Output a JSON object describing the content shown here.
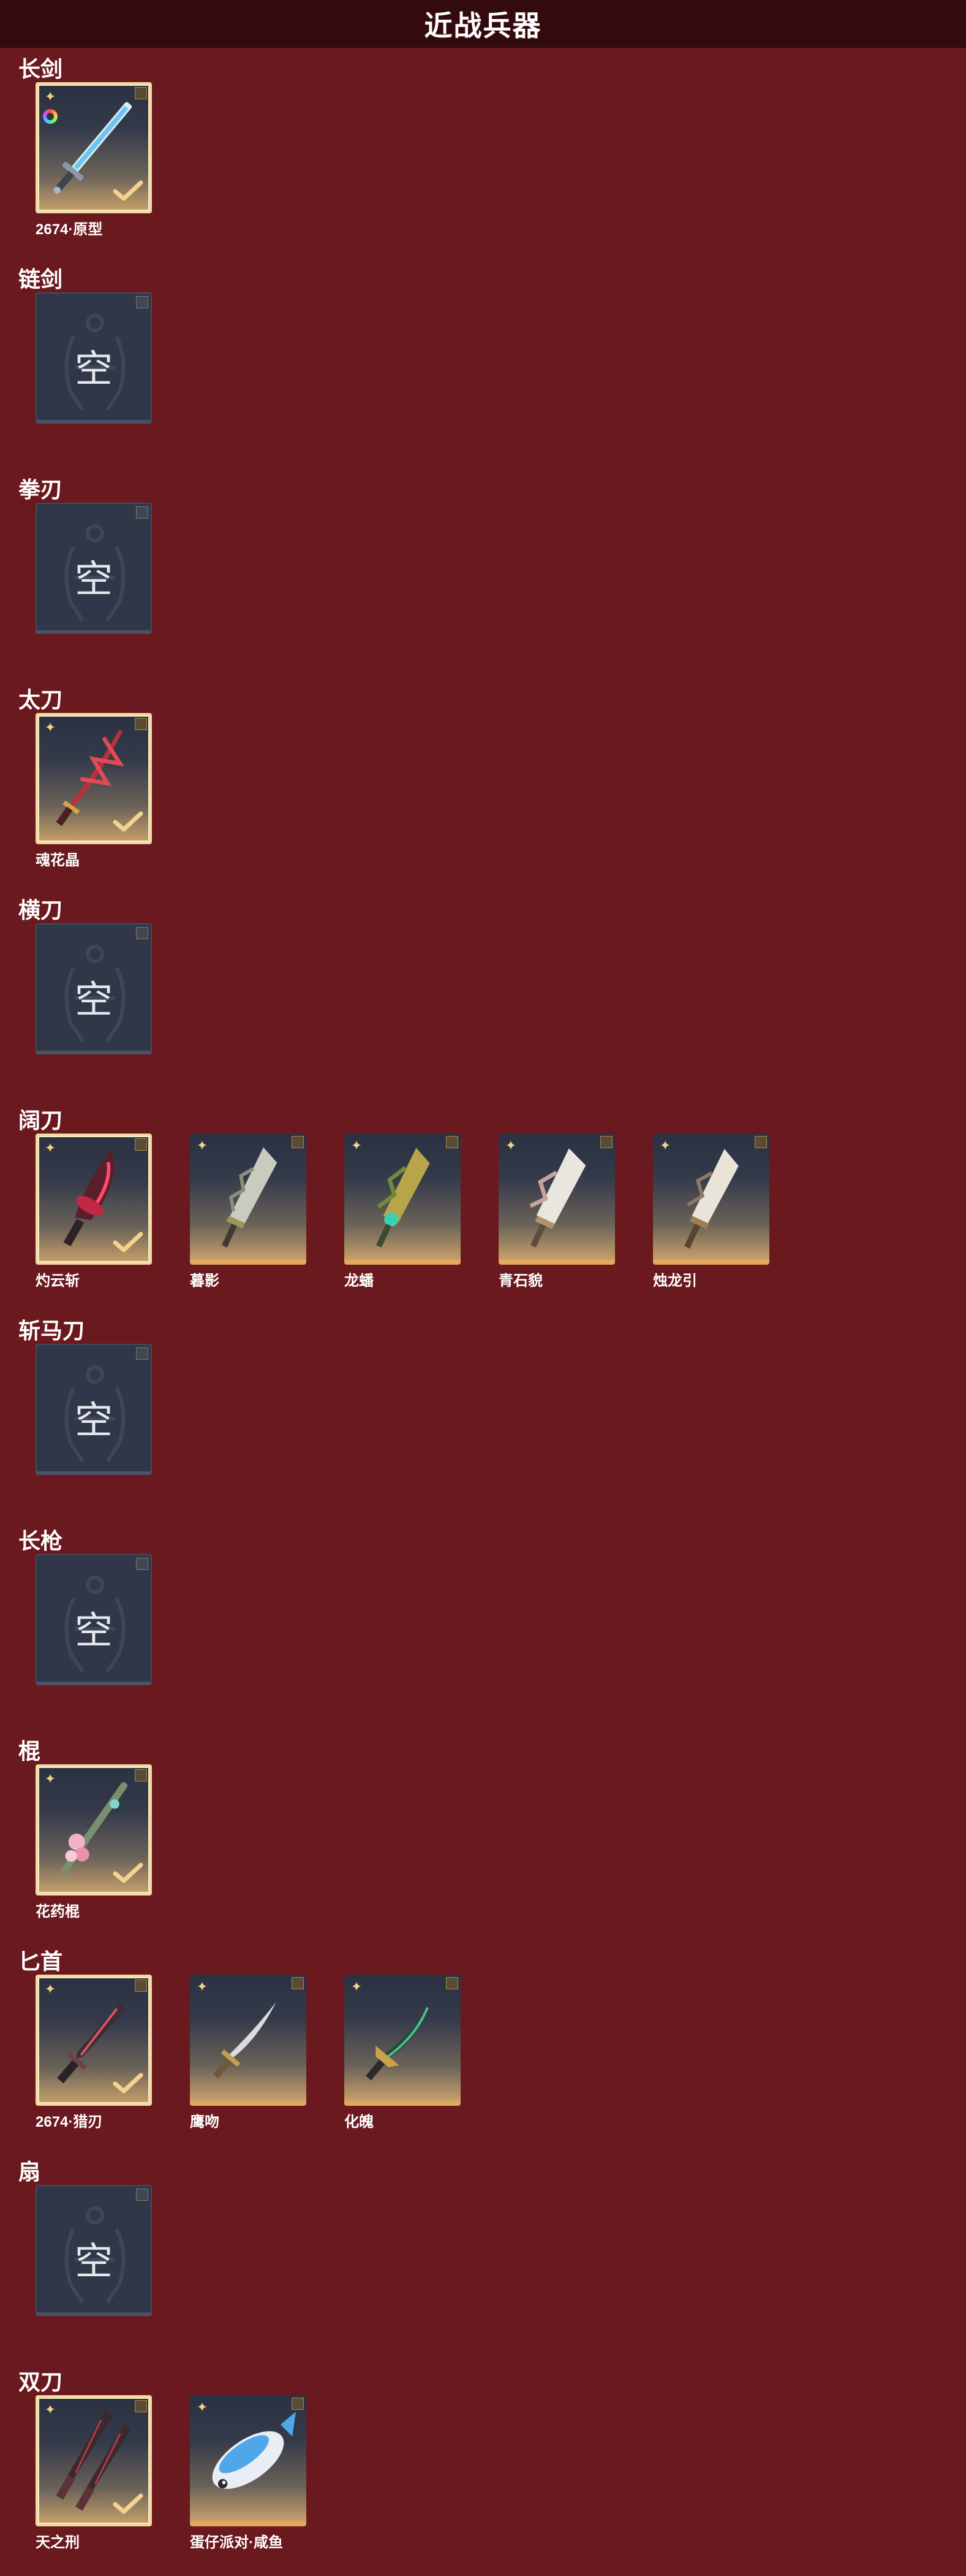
{
  "page": {
    "title": "近战兵器"
  },
  "empty_label": "空",
  "categories": [
    {
      "name": "长剑",
      "items": [
        {
          "name": "2674·原型",
          "equipped": true,
          "ring": true,
          "art": "sword-light"
        }
      ]
    },
    {
      "name": "链剑",
      "items": []
    },
    {
      "name": "拳刃",
      "items": []
    },
    {
      "name": "太刀",
      "items": [
        {
          "name": "魂花晶",
          "equipped": true,
          "art": "katana-red"
        }
      ]
    },
    {
      "name": "横刀",
      "items": []
    },
    {
      "name": "阔刀",
      "items": [
        {
          "name": "灼云斩",
          "equipped": true,
          "art": "blade-red"
        },
        {
          "name": "暮影",
          "equipped": false,
          "art": "blade-silver"
        },
        {
          "name": "龙蟠",
          "equipped": false,
          "art": "blade-gold"
        },
        {
          "name": "青石貌",
          "equipped": false,
          "art": "blade-white"
        },
        {
          "name": "烛龙引",
          "equipped": false,
          "art": "blade-white2"
        }
      ]
    },
    {
      "name": "斩马刀",
      "items": []
    },
    {
      "name": "长枪",
      "items": []
    },
    {
      "name": "棍",
      "items": [
        {
          "name": "花药棍",
          "equipped": true,
          "art": "staff-flower"
        }
      ]
    },
    {
      "name": "匕首",
      "items": [
        {
          "name": "2674·猎刃",
          "equipped": true,
          "art": "dagger-red"
        },
        {
          "name": "鹰吻",
          "equipped": false,
          "art": "dagger-silver"
        },
        {
          "name": "化魄",
          "equipped": false,
          "art": "dagger-green"
        }
      ]
    },
    {
      "name": "扇",
      "items": []
    },
    {
      "name": "双刀",
      "items": [
        {
          "name": "天之刑",
          "equipped": true,
          "art": "twin-dark"
        },
        {
          "name": "蛋仔派对·咸鱼",
          "equipped": false,
          "art": "fish"
        }
      ]
    }
  ]
}
